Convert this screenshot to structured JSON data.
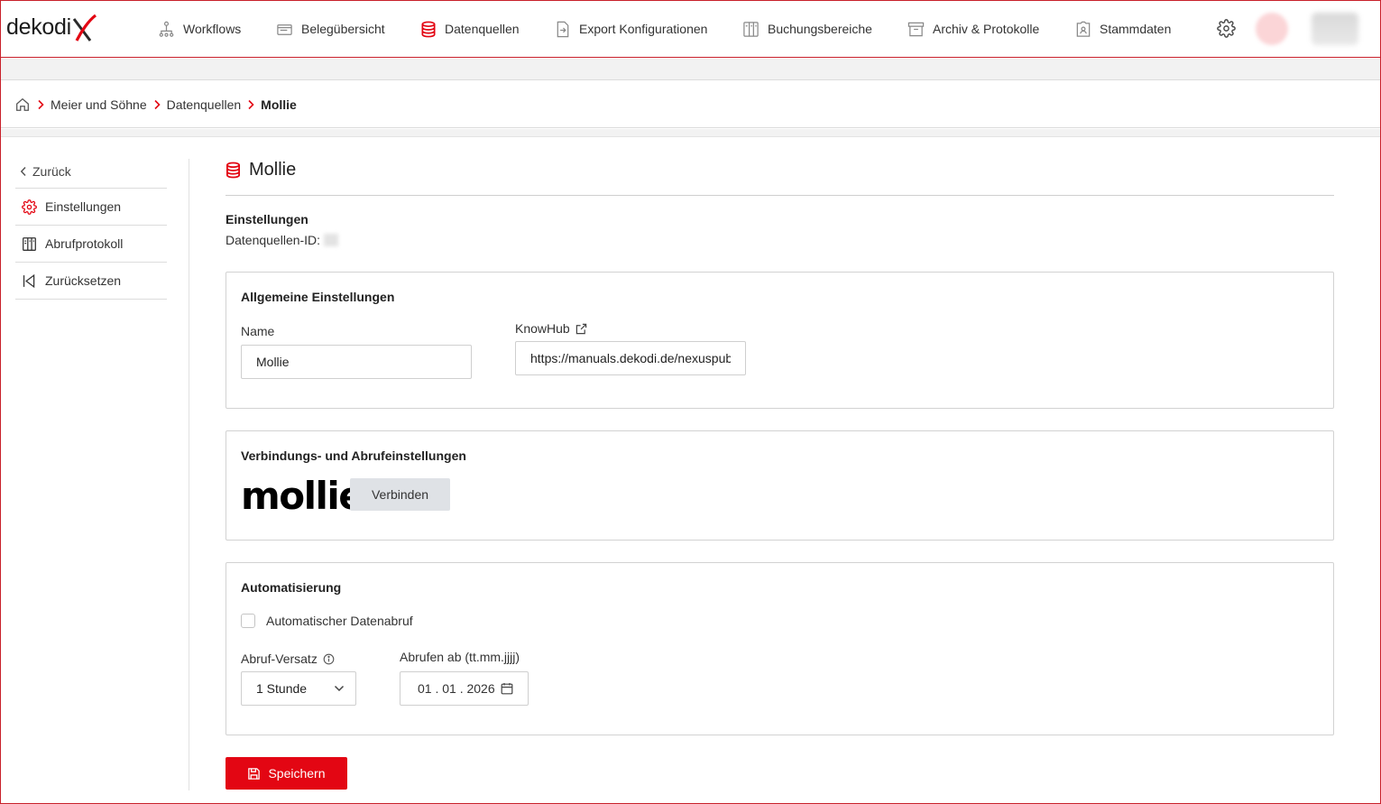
{
  "brand": {
    "logo_text": "dekodi",
    "accent_color": "#e30613"
  },
  "nav": {
    "items": [
      {
        "label": "Workflows",
        "icon": "workflow-icon"
      },
      {
        "label": "Belegübersicht",
        "icon": "document-stack-icon"
      },
      {
        "label": "Datenquellen",
        "icon": "database-icon",
        "active": true
      },
      {
        "label": "Export Konfigurationen",
        "icon": "export-file-icon"
      },
      {
        "label": "Buchungsbereiche",
        "icon": "columns-icon"
      },
      {
        "label": "Archiv & Protokolle",
        "icon": "archive-icon"
      },
      {
        "label": "Stammdaten",
        "icon": "master-data-icon"
      }
    ],
    "settings_icon": "gear-icon"
  },
  "breadcrumb": {
    "home_icon": "home-icon",
    "items": [
      "Meier und Söhne",
      "Datenquellen"
    ],
    "current": "Mollie"
  },
  "sidebar": {
    "back_label": "Zurück",
    "items": [
      {
        "label": "Einstellungen",
        "icon": "gear-icon",
        "active": true
      },
      {
        "label": "Abrufprotokoll",
        "icon": "protocol-icon"
      },
      {
        "label": "Zurücksetzen",
        "icon": "reset-icon"
      }
    ]
  },
  "page": {
    "title": "Mollie",
    "section_title": "Einstellungen",
    "id_label": "Datenquellen-ID:"
  },
  "general": {
    "title": "Allgemeine Einstellungen",
    "name_label": "Name",
    "name_value": "Mollie",
    "knowhub_label": "KnowHub",
    "knowhub_value": "https://manuals.dekodi.de/nexuspub"
  },
  "connection": {
    "title": "Verbindungs- und Abrufeinstellungen",
    "provider_logo": "mollie",
    "connect_label": "Verbinden"
  },
  "automation": {
    "title": "Automatisierung",
    "auto_fetch_label": "Automatischer Datenabruf",
    "auto_fetch_checked": false,
    "interval_label": "Abruf-Versatz",
    "interval_value": "1 Stunde",
    "from_label": "Abrufen ab (tt.mm.jjjj)",
    "from_value": "01 . 01 . 2026"
  },
  "actions": {
    "save_label": "Speichern"
  }
}
